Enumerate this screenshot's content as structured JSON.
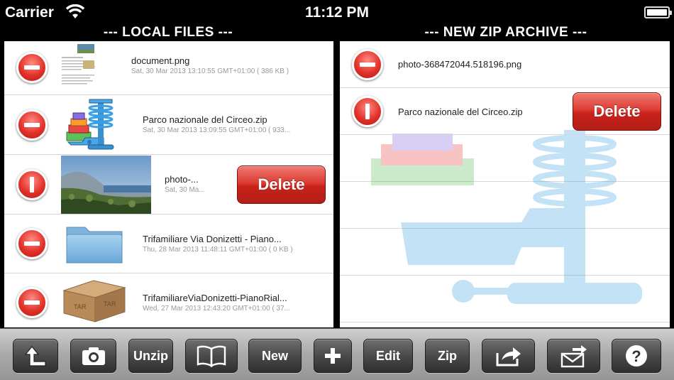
{
  "status_bar": {
    "carrier": "Carrier",
    "time": "11:12 PM",
    "wifi_icon": "wifi-icon",
    "battery_icon": "battery-icon"
  },
  "local_files": {
    "title": "--- LOCAL FILES ---",
    "items": [
      {
        "name": "document.png",
        "meta": "Sat, 30 Mar 2013 13:10:55 GMT+01:00 ( 386 KB )",
        "icon": "document-thumbnail"
      },
      {
        "name": "Parco nazionale del Circeo.zip",
        "meta": "Sat, 30 Mar 2013 13:09:55 GMT+01:00 ( 933...",
        "icon": "zip-archive-icon"
      },
      {
        "name": "photo-...",
        "meta": "Sat, 30 Ma...",
        "icon": "photo-thumbnail",
        "delete_label": "Delete"
      },
      {
        "name": "Trifamiliare Via Donizetti - Piano...",
        "meta": "Thu, 28 Mar 2013 11:48:11 GMT+01:00 ( 0 KB )",
        "icon": "folder-icon"
      },
      {
        "name": "TrifamiliareViaDonizetti-PianoRial...",
        "meta": "Wed, 27 Mar 2013 12:43:20 GMT+01:00 ( 37...",
        "icon": "tar-box-icon",
        "icon_text": "TAR"
      }
    ]
  },
  "new_zip_archive": {
    "title": "--- NEW ZIP ARCHIVE ---",
    "items": [
      {
        "name": "photo-368472044.518196.png"
      },
      {
        "name": "Parco nazionale del Circeo.zip",
        "delete_label": "Delete"
      }
    ]
  },
  "toolbar": {
    "up_icon": "arrow-up-icon",
    "camera_icon": "camera-icon",
    "unzip_label": "Unzip",
    "book_icon": "book-icon",
    "new_label": "New",
    "plus_icon": "plus-icon",
    "edit_label": "Edit",
    "zip_label": "Zip",
    "share_icon": "share-icon",
    "mail_icon": "mail-icon",
    "help_icon": "help-icon"
  },
  "colors": {
    "delete_red": "#d2332b",
    "toolbar_gray": "#a9a9a9",
    "button_dark": "#3f3f3f"
  }
}
